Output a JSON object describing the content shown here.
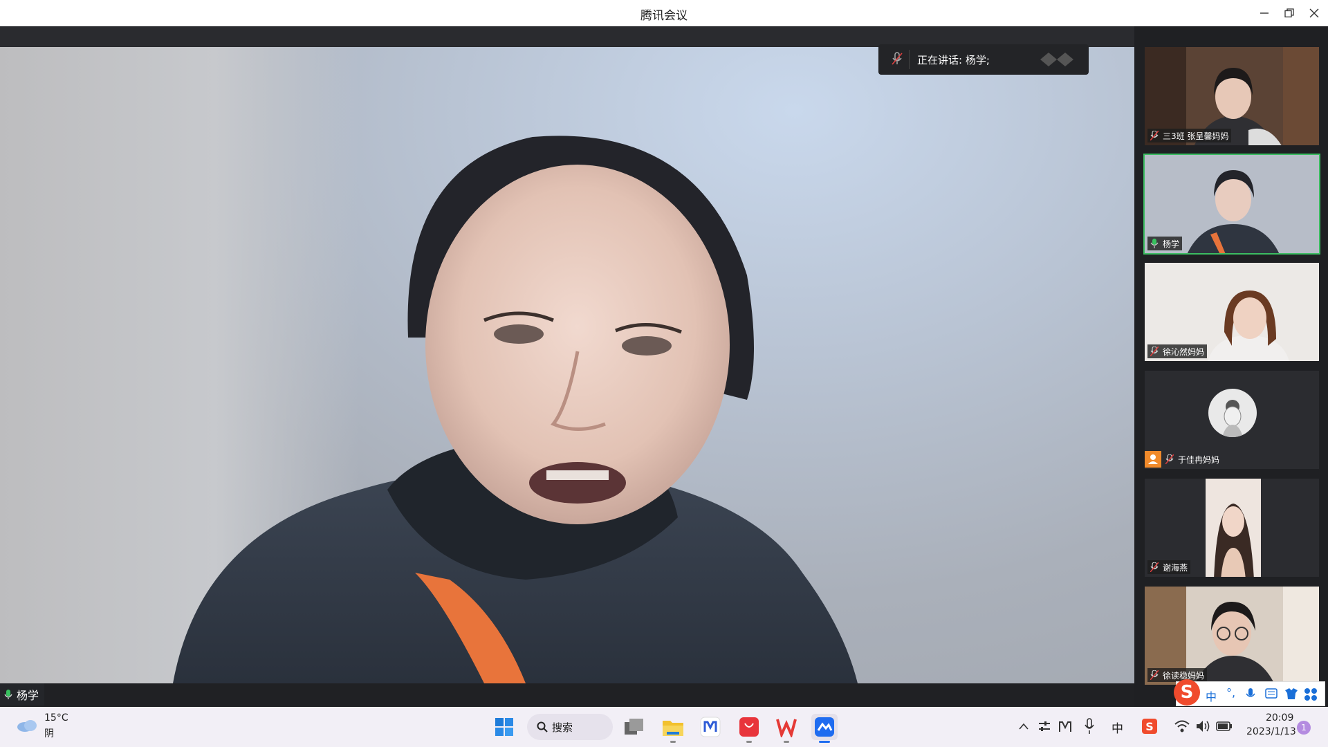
{
  "window": {
    "title": "腾讯会议"
  },
  "speaking": {
    "text": "正在讲话: 杨学;"
  },
  "main_video": {
    "name": "杨学"
  },
  "participants": [
    {
      "name": "三3班 张呈馨妈妈",
      "muted": true,
      "active": false
    },
    {
      "name": "杨学",
      "muted": false,
      "active": true
    },
    {
      "name": "徐沁然妈妈",
      "muted": true,
      "active": false
    },
    {
      "name": "于佳冉妈妈",
      "muted": true,
      "active": false
    },
    {
      "name": "谢海燕",
      "muted": true,
      "active": false
    },
    {
      "name": "徐读稳妈妈",
      "muted": true,
      "active": false
    }
  ],
  "taskbar": {
    "weather_temp": "15°C",
    "weather_desc": "阴",
    "search_label": "搜索",
    "ime_lang": "中",
    "time": "20:09",
    "date": "2023/1/13",
    "notification_count": "1"
  },
  "ime_toolbar": {
    "lang": "中"
  },
  "colors": {
    "active_border": "#3cbd62",
    "taskbar_bg": "#f2eff6"
  }
}
